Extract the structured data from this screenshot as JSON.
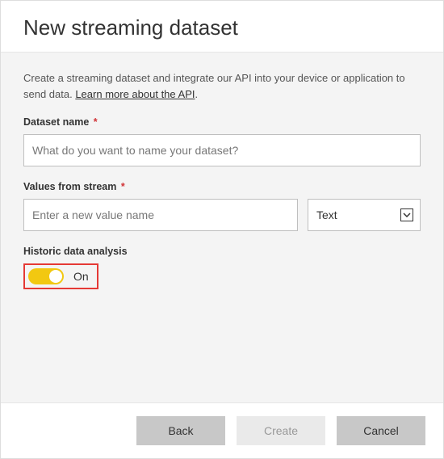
{
  "header": {
    "title": "New streaming dataset"
  },
  "description": {
    "text_prefix": "Create a streaming dataset and integrate our API into your device or application to send data. ",
    "link_text": "Learn more about the API",
    "text_suffix": "."
  },
  "fields": {
    "dataset_name": {
      "label": "Dataset name",
      "required_marker": "*",
      "placeholder": "What do you want to name your dataset?",
      "value": ""
    },
    "values_from_stream": {
      "label": "Values from stream",
      "required_marker": "*",
      "placeholder": "Enter a new value name",
      "value": "",
      "type_selected": "Text"
    },
    "historic": {
      "label": "Historic data analysis",
      "state_label": "On"
    }
  },
  "footer": {
    "back": "Back",
    "create": "Create",
    "cancel": "Cancel"
  }
}
